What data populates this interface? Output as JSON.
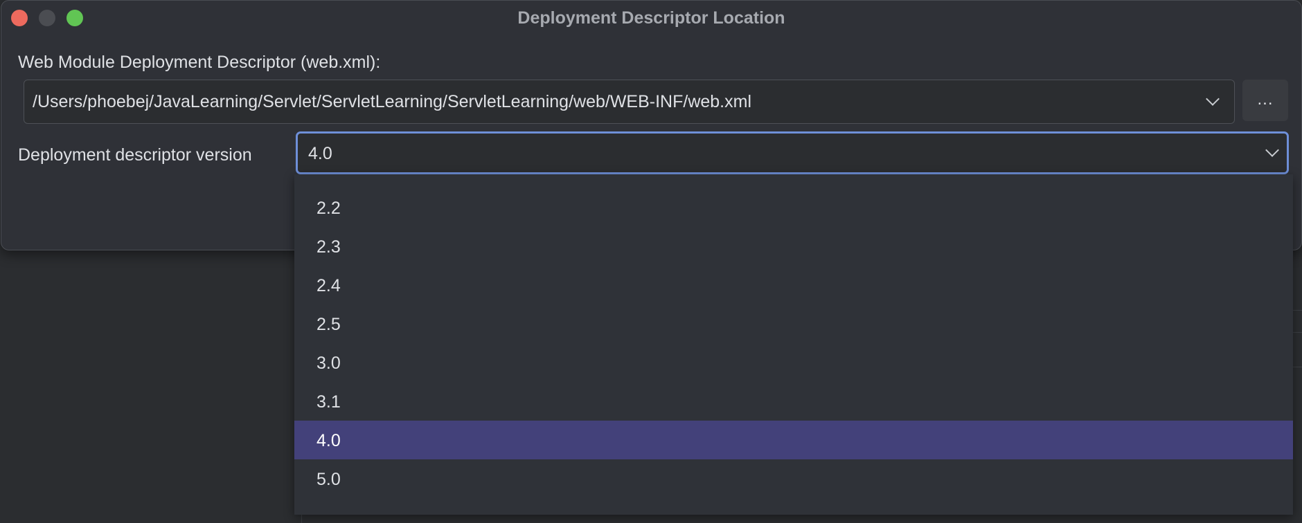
{
  "window": {
    "title": "Deployment Descriptor Location"
  },
  "descriptor": {
    "label": "Web Module Deployment Descriptor (web.xml):",
    "path": "/Users/phoebej/JavaLearning/Servlet/ServletLearning/ServletLearning/web/WEB-INF/web.xml",
    "browse_label": "..."
  },
  "version": {
    "label": "Deployment descriptor version",
    "selected": "4.0",
    "options": [
      "2.2",
      "2.3",
      "2.4",
      "2.5",
      "3.0",
      "3.1",
      "4.0",
      "5.0"
    ]
  },
  "colors": {
    "traffic_close": "#ed6a5e",
    "traffic_minimize": "#4b4d52",
    "traffic_maximize": "#61c554",
    "focus_border": "#6e8fd8",
    "selection": "#43417a"
  },
  "icons": {
    "dropdown": "chevron-down-icon"
  }
}
